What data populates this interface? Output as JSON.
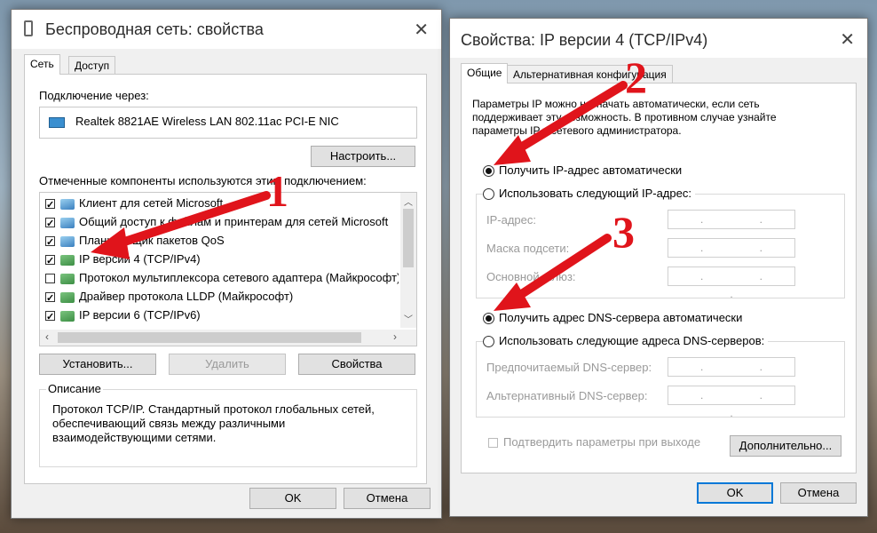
{
  "left_window": {
    "title": "Беспроводная сеть: свойства",
    "tabs": [
      "Сеть",
      "Доступ"
    ],
    "connect_using_label": "Подключение через:",
    "adapter_name": "Realtek 8821AE Wireless LAN 802.11ac PCI-E NIC",
    "configure_button": "Настроить...",
    "components_label": "Отмеченные компоненты используются этим подключением:",
    "components": [
      {
        "label": "Клиент для сетей Microsoft",
        "checked": true,
        "icon": "network-client-icon"
      },
      {
        "label": "Общий доступ к файлам и принтерам для сетей Microsoft",
        "checked": true,
        "icon": "file-share-icon"
      },
      {
        "label": "Планировщик пакетов QoS",
        "checked": true,
        "icon": "qos-icon"
      },
      {
        "label": "IP версии 4 (TCP/IPv4)",
        "checked": true,
        "icon": "protocol-icon"
      },
      {
        "label": "Протокол мультиплексора сетевого адаптера (Майкрософт)",
        "checked": false,
        "icon": "protocol-icon"
      },
      {
        "label": "Драйвер протокола LLDP (Майкрософт)",
        "checked": true,
        "icon": "protocol-icon"
      },
      {
        "label": "IP версии 6 (TCP/IPv6)",
        "checked": true,
        "icon": "protocol-icon"
      }
    ],
    "install_button": "Установить...",
    "remove_button": "Удалить",
    "properties_button": "Свойства",
    "description_label": "Описание",
    "description_text": "Протокол TCP/IP. Стандартный протокол глобальных сетей, обеспечивающий связь между различными взаимодействующими сетями.",
    "ok_button": "OK",
    "cancel_button": "Отмена"
  },
  "right_window": {
    "title": "Свойства: IP версии 4 (TCP/IPv4)",
    "tabs": [
      "Общие",
      "Альтернативная конфигурация"
    ],
    "intro_text": "Параметры IP можно назначать автоматически, если сеть поддерживает эту возможность. В противном случае узнайте параметры IP у сетевого администратора.",
    "ip_auto_label": "Получить IP-адрес автоматически",
    "ip_manual_label": "Использовать следующий IP-адрес:",
    "ip_address_label": "IP-адрес:",
    "subnet_label": "Маска подсети:",
    "gateway_label": "Основной шлюз:",
    "ip_placeholder": ". . .",
    "dns_auto_label": "Получить адрес DNS-сервера автоматически",
    "dns_manual_label": "Использовать следующие адреса DNS-серверов:",
    "preferred_dns_label": "Предпочитаемый DNS-сервер:",
    "alternate_dns_label": "Альтернативный DNS-сервер:",
    "validate_label": "Подтвердить параметры при выходе",
    "advanced_button": "Дополнительно...",
    "ok_button": "OK",
    "cancel_button": "Отмена"
  },
  "annotations": [
    "1",
    "2",
    "3"
  ],
  "colors": {
    "arrow": "#e0141b",
    "accent": "#0078d7"
  }
}
